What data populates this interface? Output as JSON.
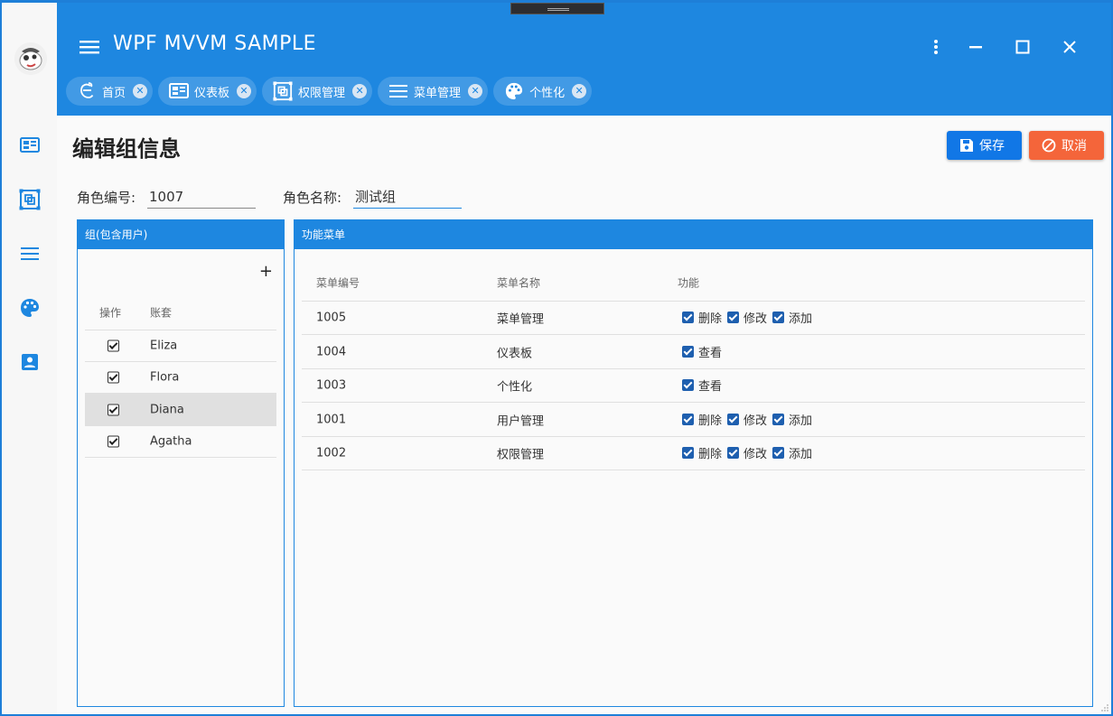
{
  "app": {
    "title": "WPF MVVM SAMPLE"
  },
  "tabs": [
    {
      "label": "首页",
      "icon": "ie-icon"
    },
    {
      "label": "仪表板",
      "icon": "dashboard-icon"
    },
    {
      "label": "权限管理",
      "icon": "select-icon"
    },
    {
      "label": "菜单管理",
      "icon": "menu-icon"
    },
    {
      "label": "个性化",
      "icon": "palette-icon"
    }
  ],
  "sidebar": {
    "items": [
      {
        "icon": "dashboard-icon"
      },
      {
        "icon": "select-icon"
      },
      {
        "icon": "menu-icon"
      },
      {
        "icon": "palette-icon"
      },
      {
        "icon": "account-box-icon"
      }
    ]
  },
  "page": {
    "title": "编辑组信息",
    "save_label": "保存",
    "cancel_label": "取消"
  },
  "form": {
    "id_label": "角色编号:",
    "id_value": "1007",
    "name_label": "角色名称:",
    "name_value": "测试组"
  },
  "group_panel": {
    "title": "组(包含用户)",
    "add_label": "+",
    "columns": [
      "操作",
      "账套"
    ],
    "users": [
      {
        "name": "Eliza",
        "checked": true
      },
      {
        "name": "Flora",
        "checked": true
      },
      {
        "name": "Diana",
        "checked": true,
        "selected": true
      },
      {
        "name": "Agatha",
        "checked": true
      }
    ]
  },
  "menu_panel": {
    "title": "功能菜单",
    "columns": [
      "菜单编号",
      "菜单名称",
      "功能"
    ],
    "rows": [
      {
        "id": "1005",
        "name": "菜单管理",
        "perms": [
          "删除",
          "修改",
          "添加"
        ]
      },
      {
        "id": "1004",
        "name": "仪表板",
        "perms": [
          "查看"
        ]
      },
      {
        "id": "1003",
        "name": "个性化",
        "perms": [
          "查看"
        ]
      },
      {
        "id": "1001",
        "name": "用户管理",
        "perms": [
          "删除",
          "修改",
          "添加"
        ]
      },
      {
        "id": "1002",
        "name": "权限管理",
        "perms": [
          "删除",
          "修改",
          "添加"
        ]
      }
    ]
  },
  "colors": {
    "primary": "#1e87e0",
    "save": "#1177e6",
    "cancel": "#f4653a",
    "checkbox": "#1e5faf",
    "selected_row": "#e0e0e0"
  }
}
